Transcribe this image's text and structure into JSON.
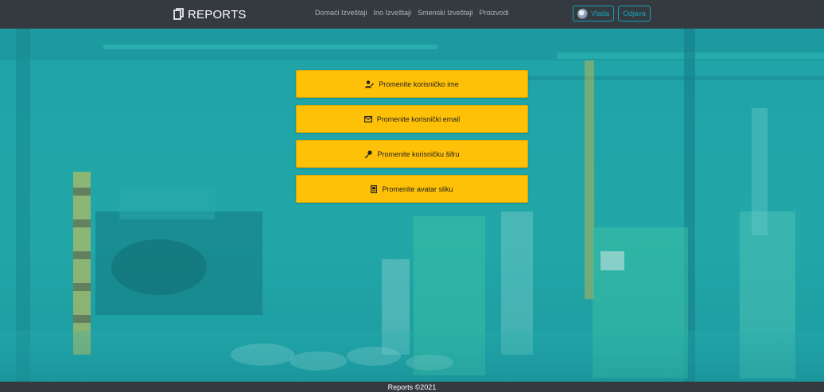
{
  "navbar": {
    "brand": "REPORTS",
    "links": [
      "Domaći Izveštaji",
      "Ino Izveštaji",
      "Smenski Izveštaji",
      "Proizvodi"
    ],
    "user_label": "Vlada",
    "logout_label": "Odjava"
  },
  "menu": {
    "items": [
      {
        "label": "Promenite korisničko ime",
        "icon": "user-edit-icon"
      },
      {
        "label": "Promenite korisnički email",
        "icon": "envelope-icon"
      },
      {
        "label": "Promenite korisničku šifru",
        "icon": "key-icon"
      },
      {
        "label": "Promenite avatar sliku",
        "icon": "image-file-icon"
      }
    ]
  },
  "footer": {
    "text": "Reports ©2021"
  },
  "colors": {
    "navbar": "#343a40",
    "accent_outline": "#17a2b8",
    "button": "#ffc107",
    "overlay": "#22a7a8"
  }
}
